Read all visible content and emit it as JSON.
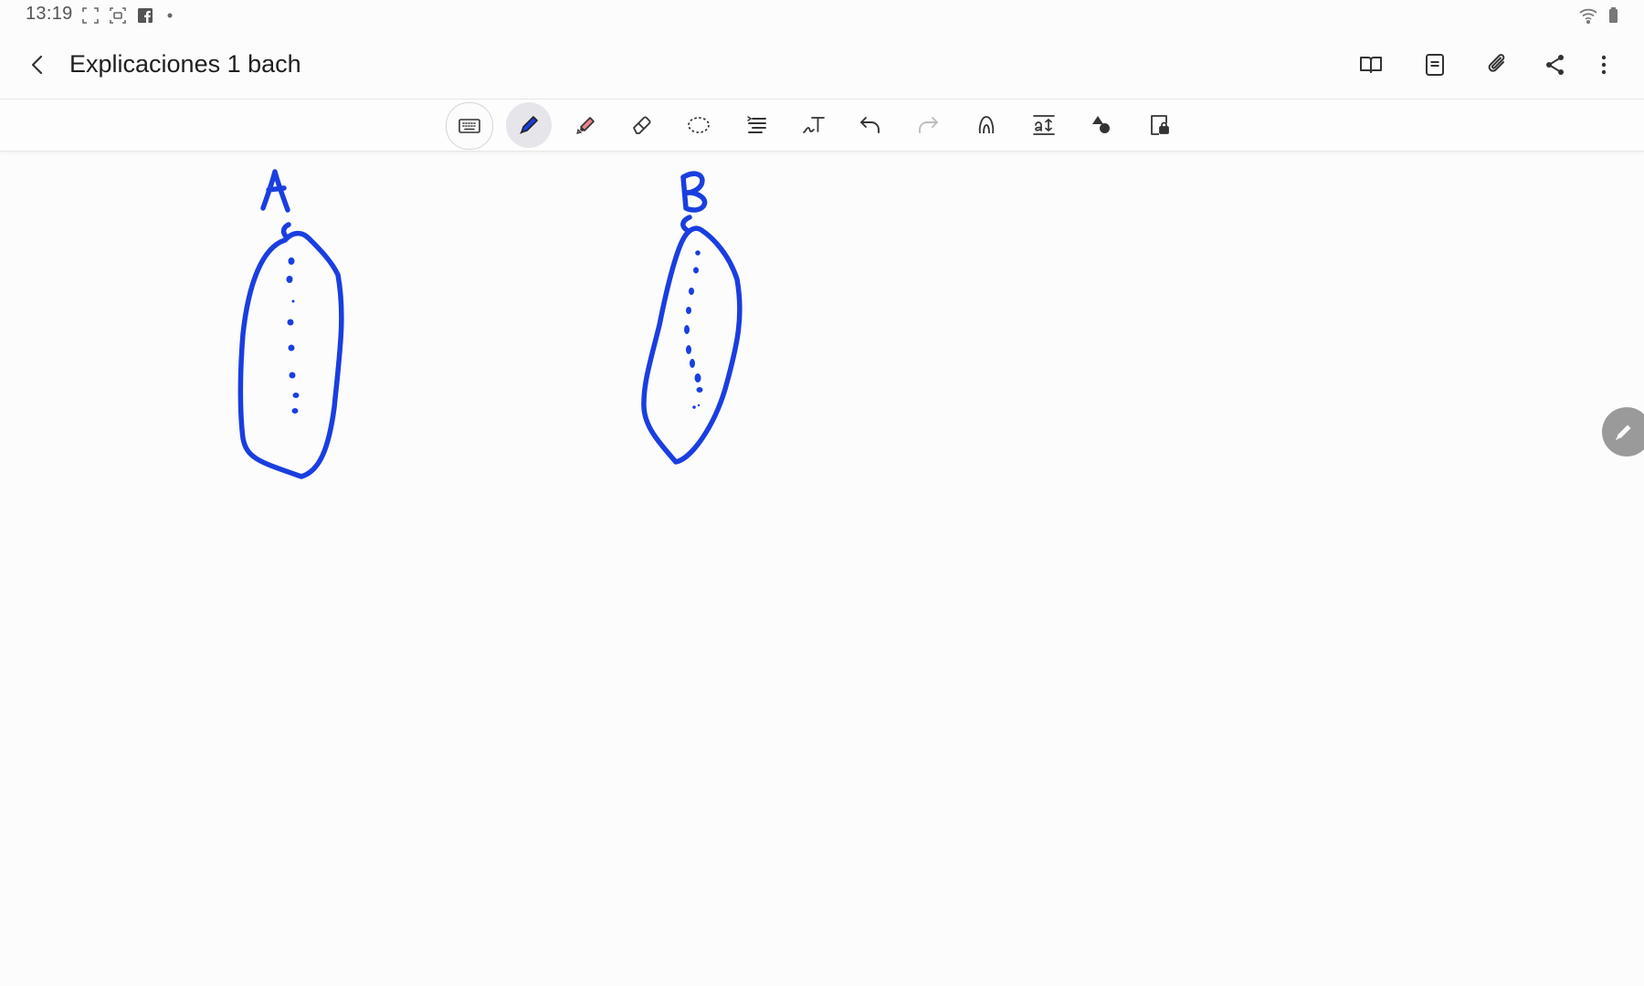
{
  "status_bar": {
    "time": "13:19",
    "icons": [
      "screenshot-frame-icon",
      "screen-record-icon",
      "facebook-icon",
      "notification-dot-icon",
      "wifi-icon",
      "battery-icon"
    ]
  },
  "app_bar": {
    "back_icon": "chevron-left-icon",
    "title": "Explicaciones 1 bach",
    "actions": [
      "book-view-icon",
      "page-layout-icon",
      "attach-icon",
      "share-icon",
      "more-vert-icon"
    ]
  },
  "toolbar": {
    "tools": [
      "keyboard-icon",
      "pen-icon",
      "highlighter-icon",
      "eraser-icon",
      "lasso-select-icon",
      "text-align-icon",
      "handwriting-text-icon",
      "undo-icon",
      "redo-icon",
      "shape-icon",
      "text-size-icon",
      "shapes-fill-icon",
      "lock-page-icon"
    ],
    "active_tool": "pen-icon"
  },
  "canvas": {
    "ink_color": "#1a3ee0",
    "labels": [
      "A",
      "B"
    ]
  },
  "floating_button": {
    "icon": "pencil-icon"
  },
  "colors": {
    "ink": "#1a3ee0",
    "background": "#fcfcfc",
    "icon": "#3a3a3a",
    "highlighter": "#e8848c"
  }
}
